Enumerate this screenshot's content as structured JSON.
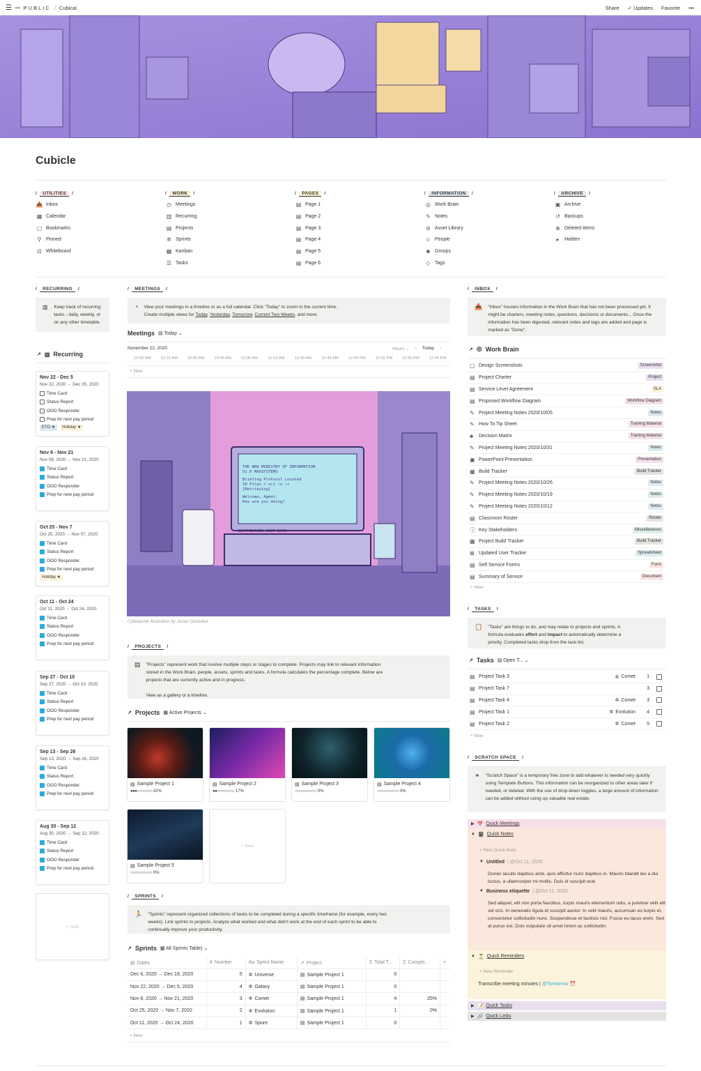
{
  "topbar": {
    "menu_icon": "hamburger-icon",
    "brand": "PUBLIC",
    "crumb_sep": "/",
    "crumb": "Cubical",
    "share": "Share",
    "updates": "Updates",
    "favorite": "Favorite",
    "more": "•••"
  },
  "page": {
    "title": "Cubicle"
  },
  "columns": [
    {
      "head": "UTILITIES",
      "color": "#fde6e6",
      "items": [
        {
          "icon": "inbox-icon",
          "glyph": "📥",
          "label": "Inbox"
        },
        {
          "icon": "calendar-icon",
          "glyph": "▦",
          "label": "Calendar"
        },
        {
          "icon": "bookmark-icon",
          "glyph": "▢",
          "label": "Bookmarks"
        },
        {
          "icon": "pin-icon",
          "glyph": "⚲",
          "label": "Pinned"
        },
        {
          "icon": "whiteboard-icon",
          "glyph": "⊡",
          "label": "Whiteboard"
        }
      ]
    },
    {
      "head": "WORK",
      "color": "#fbeed5",
      "items": [
        {
          "icon": "meetings-icon",
          "glyph": "◷",
          "label": "Meetings"
        },
        {
          "icon": "recurring-icon",
          "glyph": "▥",
          "label": "Recurring"
        },
        {
          "icon": "projects-icon",
          "glyph": "▤",
          "label": "Projects"
        },
        {
          "icon": "sprints-icon",
          "glyph": "✲",
          "label": "Sprints"
        },
        {
          "icon": "kanban-icon",
          "glyph": "▦",
          "label": "Kanban"
        },
        {
          "icon": "tasks-icon",
          "glyph": "☰",
          "label": "Tasks"
        }
      ]
    },
    {
      "head": "PAGES",
      "color": "#fdf3d0",
      "items": [
        {
          "icon": "page-icon",
          "glyph": "▤",
          "label": "Page 1"
        },
        {
          "icon": "page-icon",
          "glyph": "▤",
          "label": "Page 2"
        },
        {
          "icon": "page-icon",
          "glyph": "▤",
          "label": "Page 3"
        },
        {
          "icon": "page-icon",
          "glyph": "▤",
          "label": "Page 4"
        },
        {
          "icon": "page-icon",
          "glyph": "▤",
          "label": "Page 5"
        },
        {
          "icon": "page-icon",
          "glyph": "▤",
          "label": "Page 6"
        }
      ]
    },
    {
      "head": "INFORMATION",
      "color": "#dfeaf6",
      "items": [
        {
          "icon": "brain-icon",
          "glyph": "◎",
          "label": "Work Brain"
        },
        {
          "icon": "notes-icon",
          "glyph": "✎",
          "label": "Notes"
        },
        {
          "icon": "asset-icon",
          "glyph": "⊘",
          "label": "Asset Library"
        },
        {
          "icon": "people-icon",
          "glyph": "☺",
          "label": "People"
        },
        {
          "icon": "groups-icon",
          "glyph": "☻",
          "label": "Groups"
        },
        {
          "icon": "tag-icon",
          "glyph": "◇",
          "label": "Tags"
        }
      ]
    },
    {
      "head": "ARCHIVE",
      "color": "#ebebea",
      "items": [
        {
          "icon": "archive-icon",
          "glyph": "▣",
          "label": "Archive"
        },
        {
          "icon": "backup-icon",
          "glyph": "↺",
          "label": "Backups"
        },
        {
          "icon": "trash-icon",
          "glyph": "⊗",
          "label": "Deleted Items"
        },
        {
          "icon": "triangle-icon",
          "glyph": "▸",
          "label": "Hidden"
        }
      ]
    }
  ],
  "recurring": {
    "head": "RECURRING",
    "callout": "Keep track of recurring tasks - daily, weekly, or on any other timetable.",
    "view": "Recurring",
    "new": "+ New",
    "cards": [
      {
        "title": "Nov 22 - Dec 5",
        "dates": "Nov 22, 2020 → Dec 05, 2020",
        "done": false,
        "tasks": [
          "Time Card",
          "Status Report",
          "OOO Responder",
          "Prep for next pay period"
        ],
        "tags": [
          "ETO ★",
          "Holiday ★"
        ]
      },
      {
        "title": "Nov 8 - Nov 21",
        "dates": "Nov 08, 2020 → Nov 21, 2020",
        "done": true,
        "tasks": [
          "Time Card",
          "Status Report",
          "OOO Responder",
          "Prep for next pay period"
        ],
        "tags": []
      },
      {
        "title": "Oct 25 - Nov 7",
        "dates": "Oct 25, 2020 → Nov 07, 2020",
        "done": true,
        "tasks": [
          "Time Card",
          "Status Report",
          "OOO Responder",
          "Prep for next pay period"
        ],
        "tags": [
          "Holiday ★"
        ]
      },
      {
        "title": "Oct 11 - Oct 24",
        "dates": "Oct 11, 2020 → Oct 24, 2020",
        "done": true,
        "tasks": [
          "Time Card",
          "Status Report",
          "OOO Responder",
          "Prep for next pay period"
        ],
        "tags": []
      },
      {
        "title": "Sep 27 - Oct 10",
        "dates": "Sep 27, 2020 → Oct 10, 2020",
        "done": true,
        "tasks": [
          "Time Card",
          "Status Report",
          "OOO Responder",
          "Prep for next pay period"
        ],
        "tags": []
      },
      {
        "title": "Sep 13 - Sep 26",
        "dates": "Sep 13, 2020 → Sep 26, 2020",
        "done": true,
        "tasks": [
          "Time Card",
          "Status Report",
          "OOO Responder",
          "Prep for next pay period"
        ],
        "tags": []
      },
      {
        "title": "Aug 30 - Sep 12",
        "dates": "Aug 30, 2020 → Sep 12, 2020",
        "done": true,
        "tasks": [
          "Time Card",
          "Status Report",
          "OOO Responder",
          "Prep for next pay period"
        ],
        "tags": []
      }
    ]
  },
  "meetings": {
    "head": "MEETINGS",
    "callout_line1": "View your meetings in a timeline or as a full calendar. Click \"Today\" to zoom to the current time.",
    "callout_line2a": "Create multiple views for ",
    "links": [
      "Today",
      "Yesterday",
      "Tomorrow",
      "Current Two Weeks"
    ],
    "callout_end": ", and more.",
    "view": "Meetings",
    "view_sel": "Today",
    "date": "November 22, 2020",
    "hours": "Hours",
    "today": "Today",
    "times": [
      "10:00 AM",
      "10:15 AM",
      "10:30 AM",
      "10:45 AM",
      "11:00 AM",
      "11:15 AM",
      "11:30 AM",
      "11:45 AM",
      "12:00 PM",
      "12:15 PM",
      "12:30 PM",
      "12:45 PM"
    ],
    "new": "+ New",
    "screen_lines": [
      "THE NEW MINISTRY OF INFORMATION",
      "V1.0 MAXSYSTEMS",
      "Briefing Protocol Located",
      "10 Files / orj ~v ~r",
      "[Retrieving]",
      "Welcome, Agent.",
      "How are you doing?"
    ],
    "plate": "DEATHBURGER_UNIT B376",
    "caption": "Cyberpunk illustration by Josan Gonzalez"
  },
  "projects": {
    "head": "PROJECTS",
    "callout_l1": "\"Projects\" represent work that involve multiple steps or stages to complete. Projects may link to relevant information",
    "callout_l2": "stored in the Work Brain, people, assets, sprints and tasks. A formula calculates the percentage complete. Below are",
    "callout_l3": "projects that are currently active and in progress.",
    "callout_l4": "View as a gallery or a timeline.",
    "view": "Projects",
    "view_sel": "Active Projects",
    "new": "+ New",
    "items": [
      {
        "name": "Sample Project 1",
        "dots": "●●●○○○○○○○",
        "pct": "42%"
      },
      {
        "name": "Sample Project 2",
        "dots": "●●○○○○○○○○",
        "pct": "17%"
      },
      {
        "name": "Sample Project 3",
        "dots": "○○○○○○○○○○",
        "pct": "0%"
      },
      {
        "name": "Sample Project 4",
        "dots": "○○○○○○○○○○",
        "pct": "0%"
      },
      {
        "name": "Sample Project 5",
        "dots": "○○○○○○○○○○",
        "pct": "0%"
      }
    ]
  },
  "sprints": {
    "head": "SPRINTS",
    "callout_l1": "\"Sprints\" represent organized collections of tasks to be completed during a specific timeframe (for example, every two",
    "callout_l2": "weeks). Link sprints to projects. Analyze what worked and what didn't work at the end of each sprint to be able to",
    "callout_l3": "continually improve your productivity.",
    "view": "Sprints",
    "view_sel": "All Sprints Table)",
    "cols": [
      "Dates",
      "Number",
      "Sprint Name",
      "Project",
      "Total T...",
      "Comple...",
      "+"
    ],
    "rows": [
      [
        "Dec 6, 2020 → Dec 19, 2020",
        "5",
        "Universe",
        "Sample Project 1",
        "0",
        ""
      ],
      [
        "Nov 22, 2020 → Dec 5, 2020",
        "4",
        "Galaxy",
        "Sample Project 1",
        "0",
        ""
      ],
      [
        "Nov 8, 2020 → Nov 21, 2020",
        "3",
        "Comet",
        "Sample Project 1",
        "4",
        "25%"
      ],
      [
        "Oct 25, 2020 → Nov 7, 2020",
        "2",
        "Evolution",
        "Sample Project 1",
        "1",
        "0%"
      ],
      [
        "Oct 11, 2020 → Oct 24, 2020",
        "1",
        "Spore",
        "Sample Project 1",
        "0",
        ""
      ]
    ],
    "new": "+ New"
  },
  "inbox": {
    "head": "INBOX",
    "callout": "\"Inbox\" houses information in the Work Brain that has not been processed yet. It might be charters, meeting notes, questions, decisions or documents... Once the information has been digested, relevant notes and tags are added and page is marked as \"Done\".",
    "view": "Work Brain",
    "new": "+ New",
    "items": [
      {
        "icon": "image-icon",
        "glyph": "▢",
        "name": "Design Screenshots",
        "tag": "Screenshot",
        "bg": "#e8deee"
      },
      {
        "icon": "doc-icon",
        "glyph": "▤",
        "name": "Project Charter",
        "tag": "Project",
        "bg": "#e8deee"
      },
      {
        "icon": "doc-icon",
        "glyph": "▤",
        "name": "Service Level Agreement",
        "tag": "SLA",
        "bg": "#fbf3db"
      },
      {
        "icon": "diagram-icon",
        "glyph": "▤",
        "name": "Proposed Workflow Diagram",
        "tag": "Workflow Diagram",
        "bg": "#f4dfeb"
      },
      {
        "icon": "notes-icon",
        "glyph": "✎",
        "name": "Project Meeting Notes 2020/10/05",
        "tag": "Notes",
        "bg": "#ddebf1"
      },
      {
        "icon": "notes-icon",
        "glyph": "✎",
        "name": "How To Tip Sheet",
        "tag": "Training Material",
        "bg": "#f4dfeb"
      },
      {
        "icon": "matrix-icon",
        "glyph": "♣",
        "name": "Decision Matrix",
        "tag": "Training Material",
        "bg": "#f4dfeb"
      },
      {
        "icon": "notes-icon",
        "glyph": "✎",
        "name": "Project Meeting Notes 2020/10/31",
        "tag": "Notes",
        "bg": "#ddebf1"
      },
      {
        "icon": "ppt-icon",
        "glyph": "▣",
        "name": "PowerPoint Presentation",
        "tag": "Presentation",
        "bg": "#f4dfeb"
      },
      {
        "icon": "build-icon",
        "glyph": "▦",
        "name": "Build Tracker",
        "tag": "Build Tracker",
        "bg": "#e3e2e0"
      },
      {
        "icon": "notes-icon",
        "glyph": "✎",
        "name": "Project Meeting Notes 2020/10/26",
        "tag": "Notes",
        "bg": "#ddebf1"
      },
      {
        "icon": "notes-icon",
        "glyph": "✎",
        "name": "Project Meeting Notes 2020/10/19",
        "tag": "Notes",
        "bg": "#ddebf1"
      },
      {
        "icon": "notes-icon",
        "glyph": "✎",
        "name": "Project Meeting Notes 2020/10/12",
        "tag": "Notes",
        "bg": "#ddebf1"
      },
      {
        "icon": "roster-icon",
        "glyph": "▤",
        "name": "Classroom Roster",
        "tag": "Roster",
        "bg": "#e3e2e0"
      },
      {
        "icon": "info-icon",
        "glyph": "ⓘ",
        "name": "Key Stakeholders",
        "tag": "Miscellaneous",
        "bg": "#ddedea"
      },
      {
        "icon": "build-icon",
        "glyph": "▦",
        "name": "Project Build Tracker",
        "tag": "Build Tracker",
        "bg": "#e3e2e0"
      },
      {
        "icon": "sheet-icon",
        "glyph": "⊠",
        "name": "Updated User Tracker",
        "tag": "Spreadsheet",
        "bg": "#ddebf1"
      },
      {
        "icon": "form-icon",
        "glyph": "▤",
        "name": "Self Service Forms",
        "tag": "Form",
        "bg": "#fbe4e4"
      },
      {
        "icon": "doc-icon",
        "glyph": "▤",
        "name": "Summary of Service",
        "tag": "Document",
        "bg": "#fbe4e4"
      }
    ]
  },
  "tasks": {
    "head": "TASKS",
    "callout_l1": "\"Tasks\" are things to do, and may relate to projects and sprints. A",
    "callout_l2a": "formula evaluates ",
    "effort": "effort",
    "and": " and ",
    "impact": "impact",
    "callout_l2b": " to automatically determine a",
    "callout_l3": "priority. Completed tasks drop from the task list.",
    "view": "Tasks",
    "view_sel": "Open T...",
    "new": "+ New",
    "items": [
      {
        "name": "Project Task 3",
        "sprint": "Comet",
        "pri": "1"
      },
      {
        "name": "Project Task 7",
        "sprint": "",
        "pri": "3"
      },
      {
        "name": "Project Task 4",
        "sprint": "Comet",
        "pri": "3"
      },
      {
        "name": "Project Task 1",
        "sprint": "Evolution",
        "pri": "4"
      },
      {
        "name": "Project Task 2",
        "sprint": "Comet",
        "pri": "5"
      }
    ]
  },
  "scratch": {
    "head": "SCRATCH SPACE",
    "callout": "\"Scratch Space\" is a temporary free zone to add whatever is needed very quickly using Template Buttons. This information can be reorganized to other areas later if needed, or deleted. With the use of drop-down toggles, a large amount of information can be added without using up valuable real estate.",
    "quick_meetings": "Quick Meetings",
    "quick_notes": "Quick Notes",
    "new_note": "+ New Quick Note",
    "note1_title": "Untitled",
    "note1_date": "@Oct 11, 2020",
    "note1_body": "Donec iaculis dapibus ante, quis efficitur nunc dapibus in. Mauris blandit leo a dui luctus, a ullamcorper mi mollis. Duis id suscipit erat.",
    "note2_title": "Business etiquette",
    "note2_date": "@Oct 11, 2020",
    "note2_body": "Sed aliquet, elit non porta faucibus, turpis mauris elementum odio, a pulvinar velit elit vel orci. In venenatis ligula et suscipit auctor. In velit mauris, accumsan eu turpis et, consectetur sollicitudin nunc. Suspendisse et facilisis nisi. Fusce eu lacus enim. Sed at purus est. Duis vulputate sit amet lorem ac sollicitudin.",
    "quick_reminders": "Quick Reminders",
    "new_reminder": "+ New Reminder",
    "reminder": "Transcribe meeting minutes |",
    "reminder_date": "@Tomorrow",
    "quick_tasks": "Quick Tasks",
    "quick_links": "Quick Links"
  }
}
